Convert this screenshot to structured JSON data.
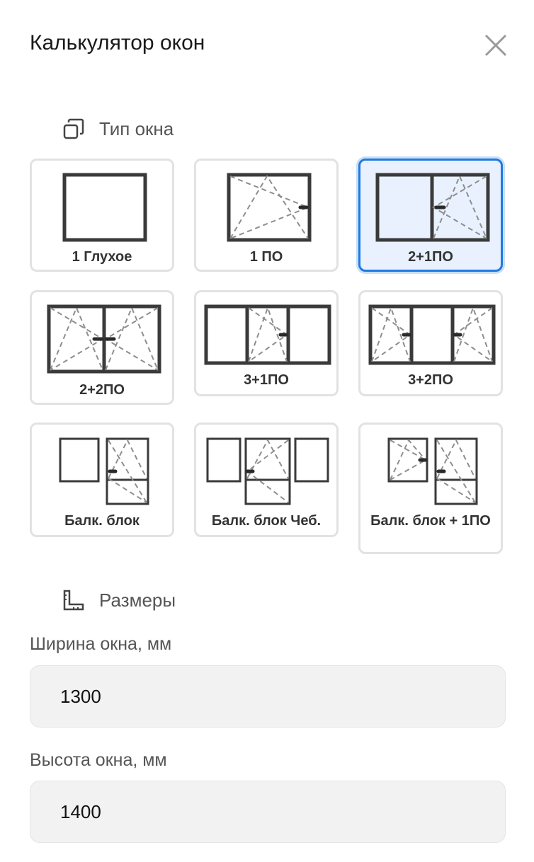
{
  "header": {
    "title": "Калькулятор окон",
    "close_icon": "close-icon"
  },
  "window_type": {
    "title": "Тип окна",
    "icon": "windows-stack-icon",
    "options": [
      {
        "label": "1 Глухое"
      },
      {
        "label": "1 ПО"
      },
      {
        "label": "2+1ПО"
      },
      {
        "label": "2+2ПО"
      },
      {
        "label": "3+1ПО"
      },
      {
        "label": "3+2ПО"
      },
      {
        "label": "Балк. блок"
      },
      {
        "label": "Балк. блок Чеб."
      },
      {
        "label": "Балк. блок + 1ПО"
      }
    ],
    "selected": "2+1ПО"
  },
  "dimensions": {
    "title": "Размеры",
    "icon": "ruler-icon",
    "width_label": "Ширина окна, мм",
    "width_value": "1300",
    "height_label": "Высота окна, мм",
    "height_value": "1400"
  },
  "colors": {
    "accent": "#1f7ae0",
    "selected_bg": "#e8f1fd",
    "tile_border": "#e2e2e2",
    "field_bg": "#f2f2f3"
  }
}
